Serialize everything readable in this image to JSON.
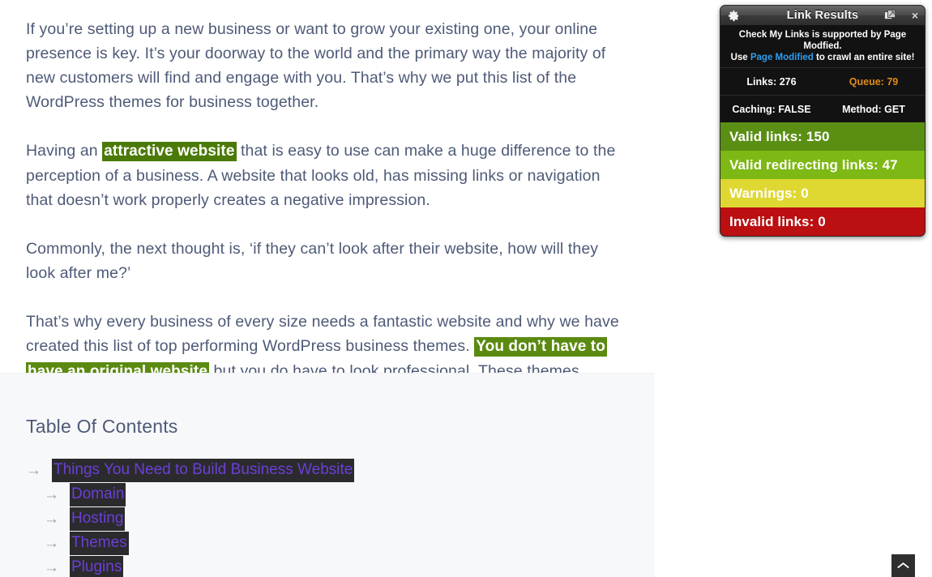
{
  "article": {
    "paragraphs": [
      {
        "id": "p1",
        "segments": [
          {
            "type": "text",
            "text": "If you’re setting up a new business or want to grow your existing one, your online presence is key. It’s your doorway to the world and the primary way the majority of new customers will find and engage with you. That’s why we put this list of the WordPress themes for business together."
          }
        ]
      },
      {
        "id": "p2",
        "segments": [
          {
            "type": "text",
            "text": "Having an "
          },
          {
            "type": "link-highlight",
            "text": "attractive website",
            "style": "dark"
          },
          {
            "type": "text",
            "text": " that is easy to use can make a huge difference to the perception of a business. A website that looks old, has missing links or navigation that doesn’t work properly creates a negative impression."
          }
        ]
      },
      {
        "id": "p3",
        "segments": [
          {
            "type": "text",
            "text": "Commonly, the next thought is, ‘if they can’t look after their website, how will they look after me?’"
          }
        ]
      },
      {
        "id": "p4",
        "segments": [
          {
            "type": "text",
            "text": "That’s why every business of every size needs a fantastic website and why we have created this list of top performing WordPress business themes. "
          },
          {
            "type": "link-highlight",
            "text": "You don’t have to have an original website",
            "style": "light"
          },
          {
            "type": "text",
            "text": " but you do have to look professional. These themes provide that."
          }
        ]
      }
    ]
  },
  "toc": {
    "title": "Table Of Contents",
    "arrow_glyph": "→",
    "items": [
      {
        "label": "Things You Need to Build Business Website",
        "level": 1
      },
      {
        "label": "Domain",
        "level": 2
      },
      {
        "label": "Hosting",
        "level": 2
      },
      {
        "label": "Themes",
        "level": 2
      },
      {
        "label": "Plugins",
        "level": 2
      }
    ]
  },
  "check_my_links": {
    "title": "Link Results",
    "close_label": "×",
    "note_line1": "Check My Links is supported by Page Modfied.",
    "note_line2_prefix": "Use ",
    "note_line2_link": "Page Modified",
    "note_line2_suffix": " to crawl an entire site!",
    "stats": [
      {
        "label": "Links: 276",
        "kind": "links"
      },
      {
        "label": "Queue: 79",
        "kind": "queue"
      },
      {
        "label": "Caching: FALSE",
        "kind": "caching"
      },
      {
        "label": "Method: GET",
        "kind": "method"
      }
    ],
    "results": [
      {
        "label": "Valid links: 150",
        "color": "#5a8f14",
        "kind": "valid"
      },
      {
        "label": "Valid redirecting links: 47",
        "color": "#7db814",
        "kind": "redirecting"
      },
      {
        "label": "Warnings: 0",
        "color": "#dfd832",
        "kind": "warnings"
      },
      {
        "label": "Invalid links: 0",
        "color": "#bb0f11",
        "kind": "invalid"
      }
    ]
  },
  "colors": {
    "body_text": "#4e5a77",
    "highlight_link_bg_dark": "#4b7a08",
    "highlight_link_bg_light": "#5b8a10",
    "toc_link_bg": "#2b2b2e",
    "toc_link_text": "#6b3fd4",
    "panel_bg": "#121212",
    "link_blue": "#2e9df0"
  }
}
